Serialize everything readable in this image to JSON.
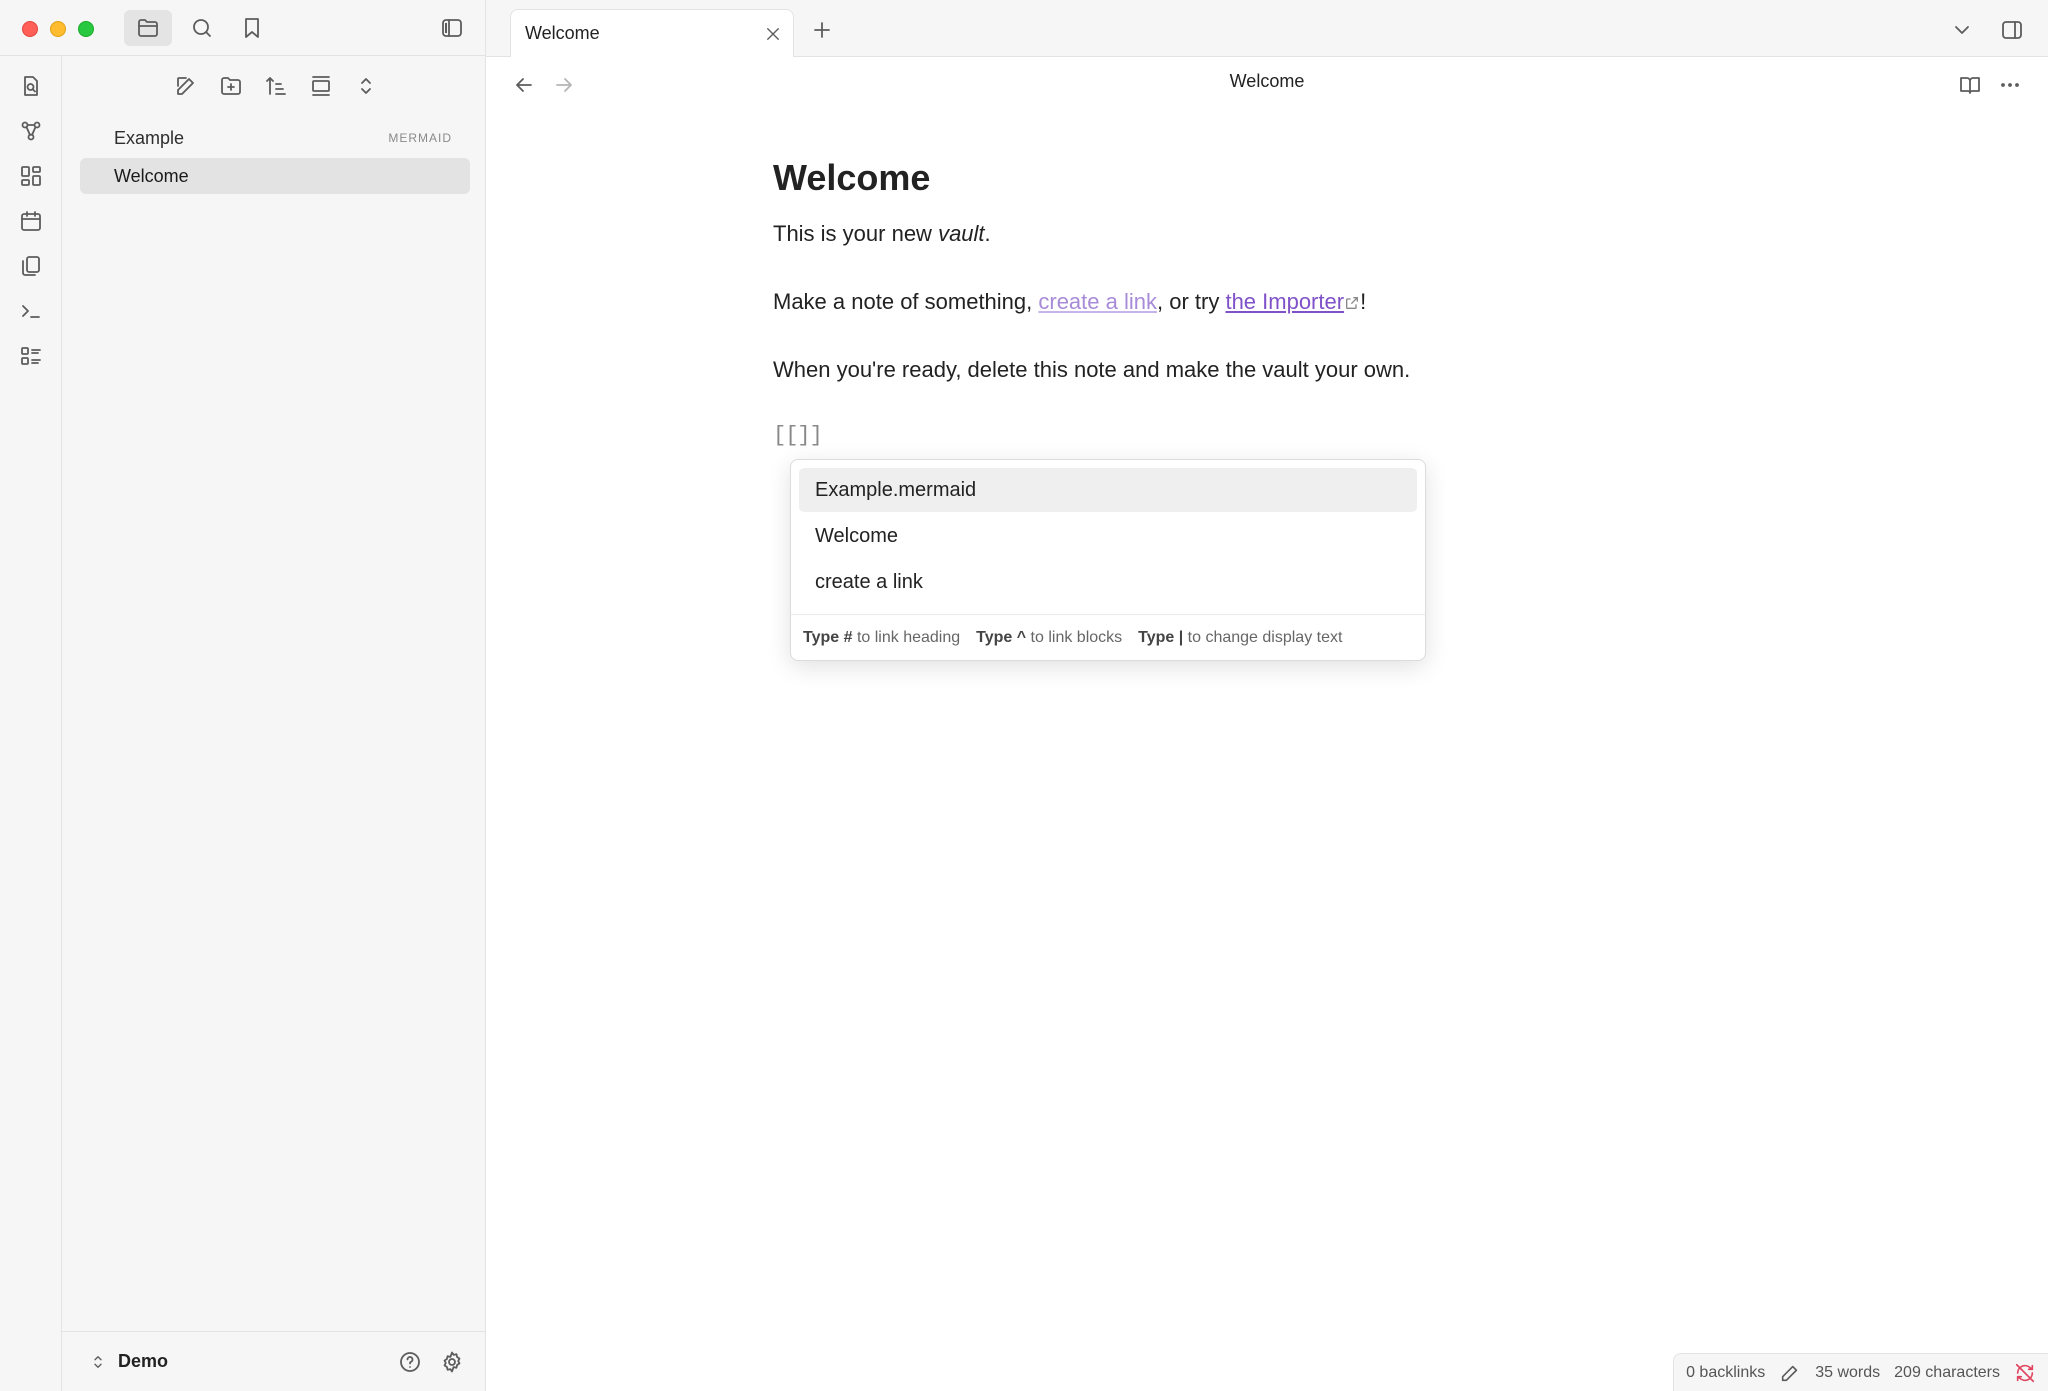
{
  "window": {
    "traffic_lights": [
      "close",
      "minimize",
      "zoom"
    ]
  },
  "sidebar_toolbar": {
    "icons": [
      "folder-icon",
      "search-icon",
      "bookmark-icon"
    ],
    "toggle": "sidebar-toggle-icon"
  },
  "ribbon": {
    "icons": [
      "open-quick-switcher-icon",
      "graph-view-icon",
      "canvas-icon",
      "daily-note-icon",
      "templates-icon",
      "command-palette-icon",
      "outline-icon"
    ]
  },
  "file_explorer": {
    "actions": [
      "new-note-icon",
      "new-folder-icon",
      "sort-icon",
      "collapse-icon",
      "expand-collapse-icon"
    ],
    "items": [
      {
        "name": "Example",
        "badge": "MERMAID"
      },
      {
        "name": "Welcome",
        "badge": ""
      }
    ],
    "vault_name": "Demo"
  },
  "tabs": [
    {
      "label": "Welcome"
    }
  ],
  "view": {
    "title": "Welcome"
  },
  "document": {
    "heading": "Welcome",
    "p1_before": "This is your new ",
    "p1_em": "vault",
    "p1_after": ".",
    "p2_before": "Make a note of something, ",
    "p2_link_internal": "create a link",
    "p2_middle": ", or try ",
    "p2_link_external": "the Importer",
    "p2_after": "!",
    "p3": "When you're ready, delete this note and make the vault your own.",
    "typing": "[[]]"
  },
  "suggestions": {
    "items": [
      "Example.mermaid",
      "Welcome",
      "create a link"
    ],
    "footer": [
      {
        "key": "Type #",
        "text": "to link heading"
      },
      {
        "key": "Type ^",
        "text": "to link blocks"
      },
      {
        "key": "Type |",
        "text": "to change display text"
      }
    ]
  },
  "status": {
    "backlinks": "0 backlinks",
    "words": "35 words",
    "characters": "209 characters"
  },
  "colors": {
    "link_internal": "#a88bd8",
    "link_external": "#7f52c9",
    "sync_error": "#e0445f"
  }
}
